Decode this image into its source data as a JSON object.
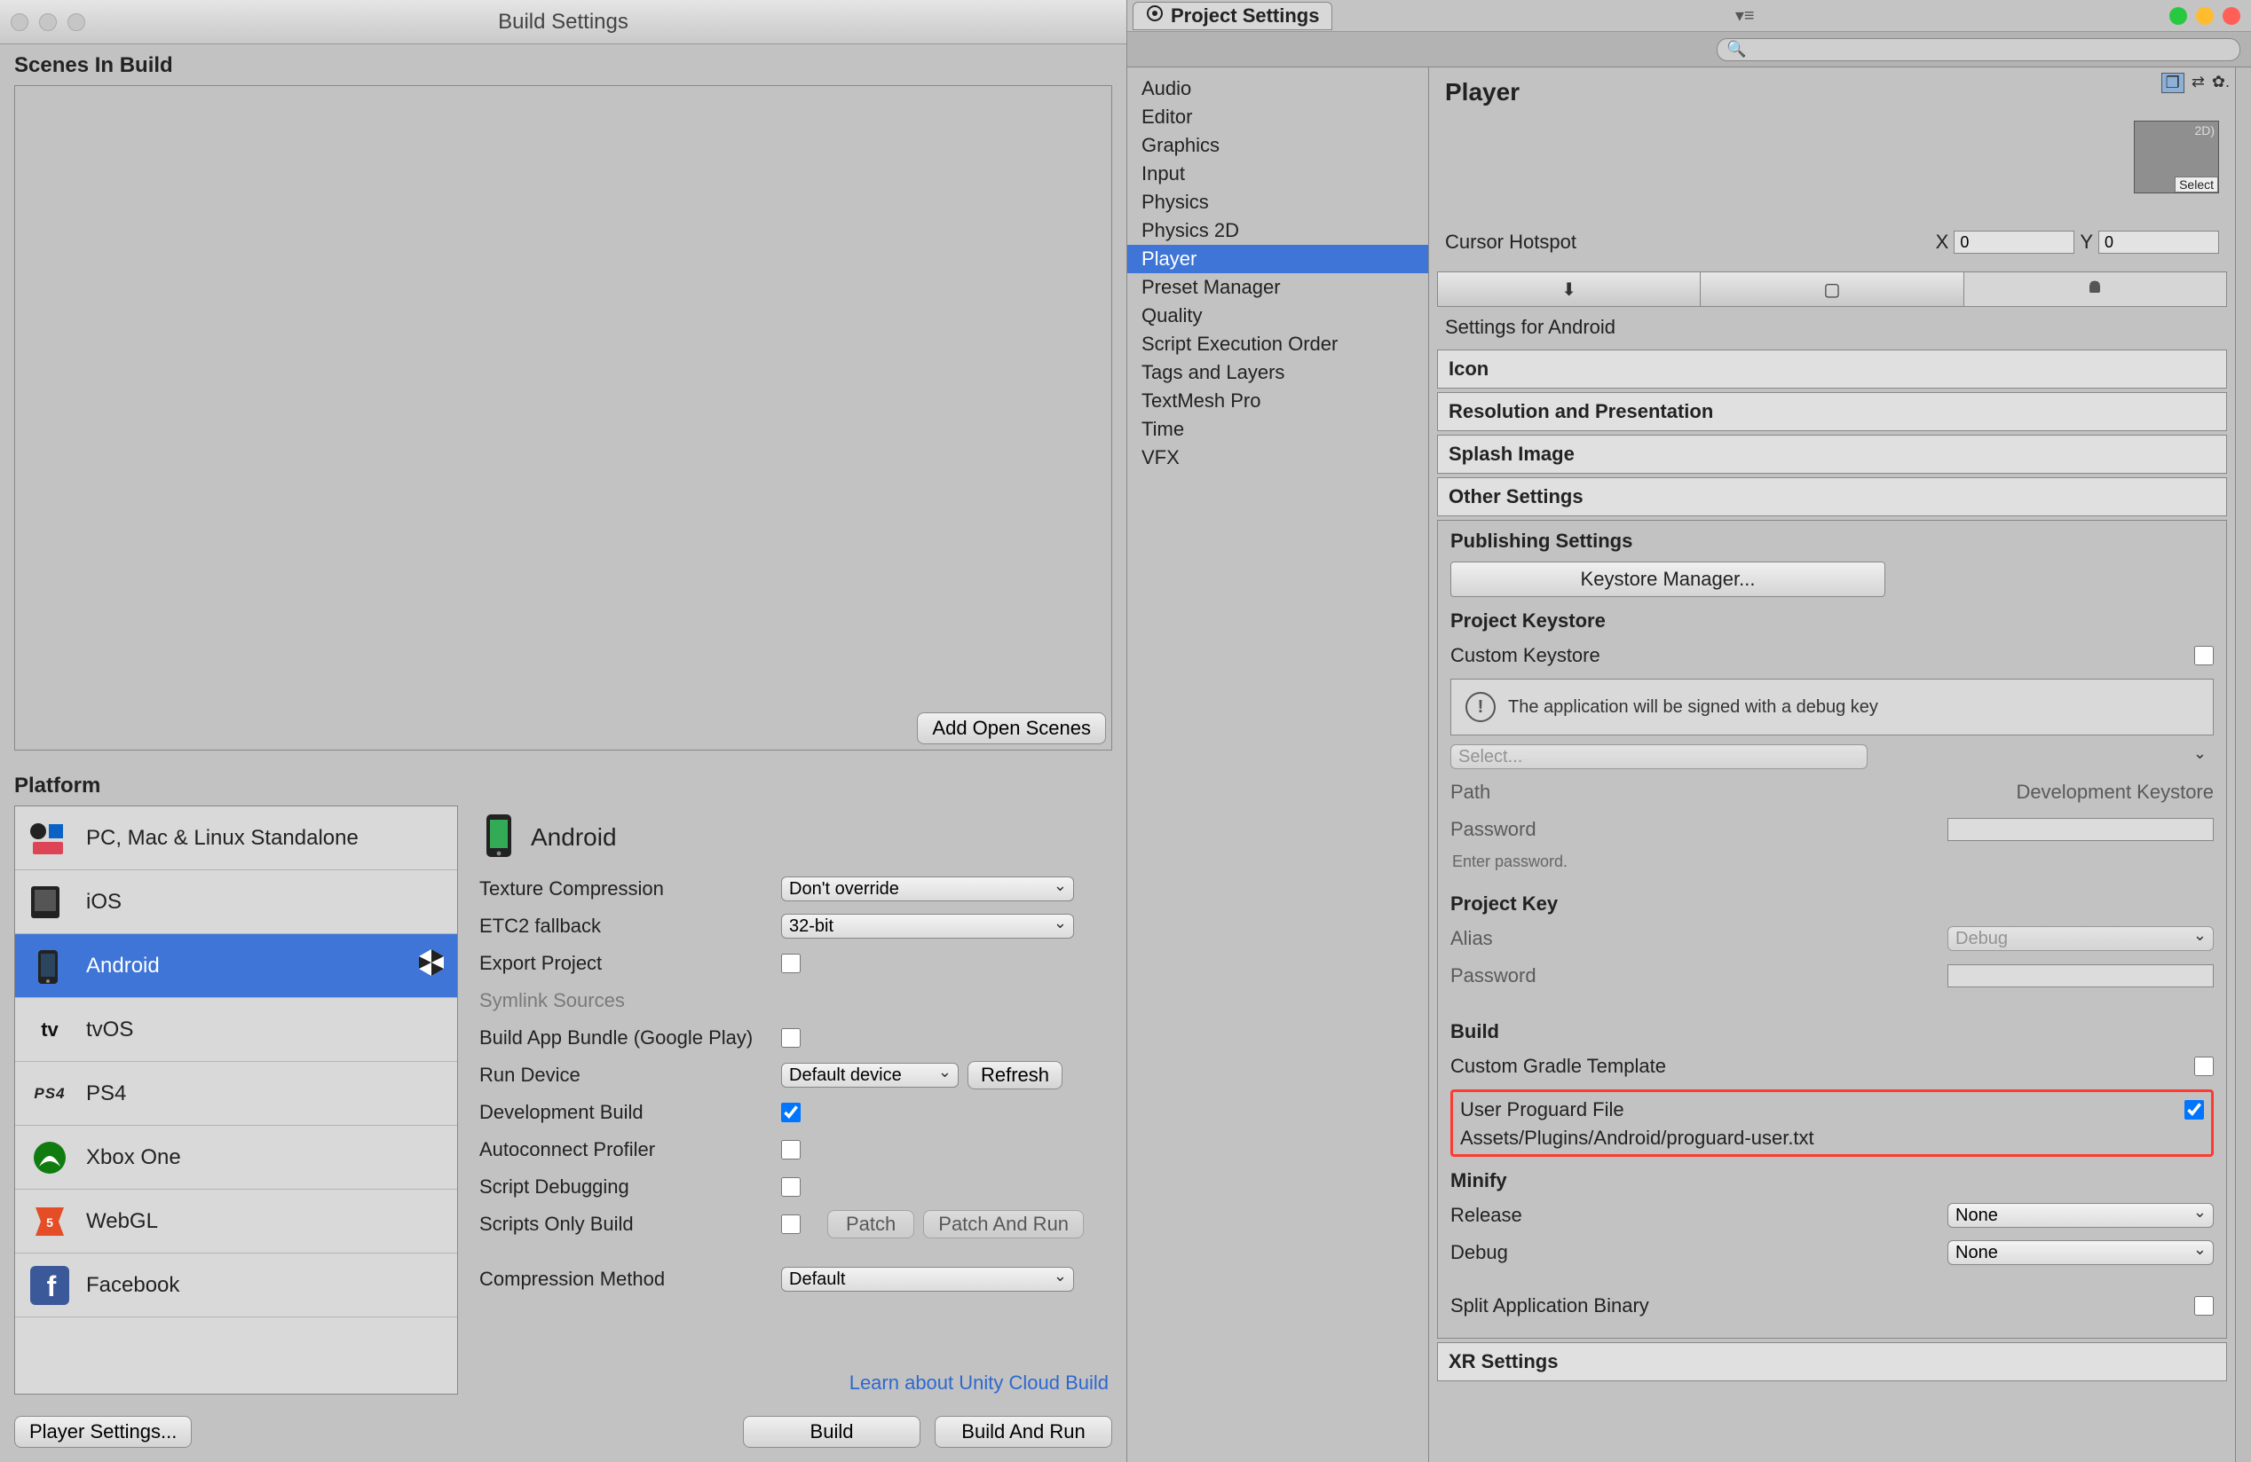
{
  "build_window": {
    "title": "Build Settings",
    "scenes_header": "Scenes In Build",
    "add_open_scenes": "Add Open Scenes",
    "platform_label": "Platform",
    "platforms": [
      "PC, Mac & Linux Standalone",
      "iOS",
      "Android",
      "tvOS",
      "PS4",
      "Xbox One",
      "WebGL",
      "Facebook"
    ],
    "selected_platform": "Android",
    "build_target_title": "Android",
    "props": {
      "texture_compression": {
        "label": "Texture Compression",
        "value": "Don't override"
      },
      "etc2_fallback": {
        "label": "ETC2 fallback",
        "value": "32-bit"
      },
      "export_project": {
        "label": "Export Project",
        "checked": false
      },
      "symlink_sources": {
        "label": "Symlink Sources",
        "disabled": true
      },
      "build_app_bundle": {
        "label": "Build App Bundle (Google Play)",
        "checked": false
      },
      "run_device": {
        "label": "Run Device",
        "value": "Default device",
        "refresh": "Refresh"
      },
      "development_build": {
        "label": "Development Build",
        "checked": true
      },
      "autoconnect_profiler": {
        "label": "Autoconnect Profiler",
        "checked": false
      },
      "script_debugging": {
        "label": "Script Debugging",
        "checked": false
      },
      "scripts_only_build": {
        "label": "Scripts Only Build",
        "checked": false,
        "patch": "Patch",
        "patch_run": "Patch And Run"
      },
      "compression_method": {
        "label": "Compression Method",
        "value": "Default"
      }
    },
    "link": "Learn about Unity Cloud Build",
    "player_settings_btn": "Player Settings...",
    "build_btn": "Build",
    "build_and_run_btn": "Build And Run"
  },
  "project_settings": {
    "tab_title": "Project Settings",
    "search_placeholder": "",
    "categories": [
      "Audio",
      "Editor",
      "Graphics",
      "Input",
      "Physics",
      "Physics 2D",
      "Player",
      "Preset Manager",
      "Quality",
      "Script Execution Order",
      "Tags and Layers",
      "TextMesh Pro",
      "Time",
      "VFX"
    ],
    "selected_category": "Player",
    "player": {
      "title": "Player",
      "thumb_label": "2D)",
      "thumb_select": "Select",
      "cursor_label": "Cursor Hotspot",
      "cursor_x_label": "X",
      "cursor_x": "0",
      "cursor_y_label": "Y",
      "cursor_y": "0",
      "platform_tabs": [
        "desktop",
        "mobile",
        "android"
      ],
      "settings_for": "Settings for Android",
      "sections": {
        "icon": "Icon",
        "resolution": "Resolution and Presentation",
        "splash": "Splash Image",
        "other": "Other Settings",
        "publishing": "Publishing Settings",
        "xr": "XR Settings"
      },
      "publishing": {
        "keystore_manager": "Keystore Manager...",
        "project_keystore": "Project Keystore",
        "custom_keystore": "Custom Keystore",
        "debug_warning": "The application will be signed with a debug key",
        "select_label": "Select...",
        "path_label": "Path",
        "path_value": "Development Keystore",
        "password_label": "Password",
        "password_hint": "Enter password.",
        "project_key": "Project Key",
        "alias_label": "Alias",
        "alias_value": "Debug",
        "password2_label": "Password",
        "build_header": "Build",
        "custom_gradle": "Custom Gradle Template",
        "user_proguard": "User Proguard File",
        "proguard_path": "Assets/Plugins/Android/proguard-user.txt",
        "minify_header": "Minify",
        "release_label": "Release",
        "release_value": "None",
        "debug_label": "Debug",
        "debug_value": "None",
        "split_binary": "Split Application Binary"
      }
    }
  }
}
